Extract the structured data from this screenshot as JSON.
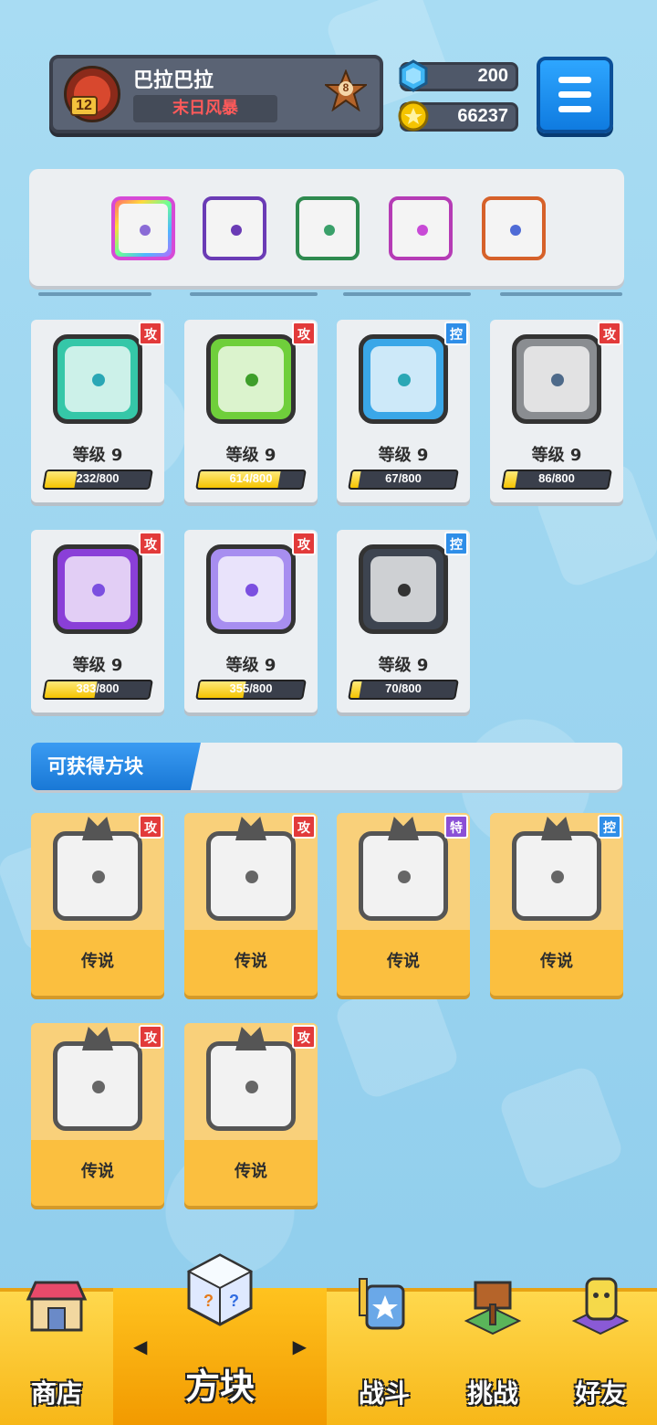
{
  "profile": {
    "name": "巴拉巴拉",
    "title": "末日风暴",
    "level": "12",
    "rank": "8"
  },
  "currency": {
    "gems": "200",
    "coins": "66237"
  },
  "deck": {
    "slots": [
      "rainbow-dice",
      "purple-dragon-dice",
      "green-dragon-dice",
      "combo-dragon-dice",
      "infinity-dragon-dice"
    ]
  },
  "owned_dice": [
    {
      "type_tag": "攻",
      "level_label": "等级 9",
      "progress": "232/800",
      "progress_fraction": 0.29,
      "color": "#35c7a8",
      "pip": "#2aa7b5"
    },
    {
      "type_tag": "攻",
      "level_label": "等级 9",
      "progress": "614/800",
      "progress_fraction": 0.77,
      "color": "#6fcf3b",
      "pip": "#3e9e2a"
    },
    {
      "type_tag": "控",
      "level_label": "等级 9",
      "progress": "67/800",
      "progress_fraction": 0.08,
      "color": "#3aa7e8",
      "pip": "#2aa7b5"
    },
    {
      "type_tag": "攻",
      "level_label": "等级 9",
      "progress": "86/800",
      "progress_fraction": 0.11,
      "color": "#8a8d91",
      "pip": "#4e6a8a"
    },
    {
      "type_tag": "攻",
      "level_label": "等级 9",
      "progress": "383/800",
      "progress_fraction": 0.48,
      "color": "#8a3fd8",
      "pip": "#7b4fe0"
    },
    {
      "type_tag": "攻",
      "level_label": "等级 9",
      "progress": "355/800",
      "progress_fraction": 0.44,
      "color": "#a78ef0",
      "pip": "#7b4fe0"
    },
    {
      "type_tag": "控",
      "level_label": "等级 9",
      "progress": "70/800",
      "progress_fraction": 0.09,
      "color": "#3d4450",
      "pip": "#333"
    }
  ],
  "obtainable": {
    "header": "可获得方块",
    "dice": [
      {
        "type_tag": "攻",
        "rarity": "传说"
      },
      {
        "type_tag": "攻",
        "rarity": "传说"
      },
      {
        "type_tag": "特",
        "rarity": "传说"
      },
      {
        "type_tag": "控",
        "rarity": "传说"
      },
      {
        "type_tag": "攻",
        "rarity": "传说"
      },
      {
        "type_tag": "攻",
        "rarity": "传说"
      }
    ]
  },
  "nav": {
    "shop": "商店",
    "dice": "方块",
    "battle": "战斗",
    "challenge": "挑战",
    "friends": "好友"
  },
  "colors": {
    "background": "#9fd6f0",
    "attack_tag": "#e23a3a",
    "control_tag": "#2f8ee8",
    "special_tag": "#8b4fd6",
    "nav_bar": "#f7b718"
  }
}
